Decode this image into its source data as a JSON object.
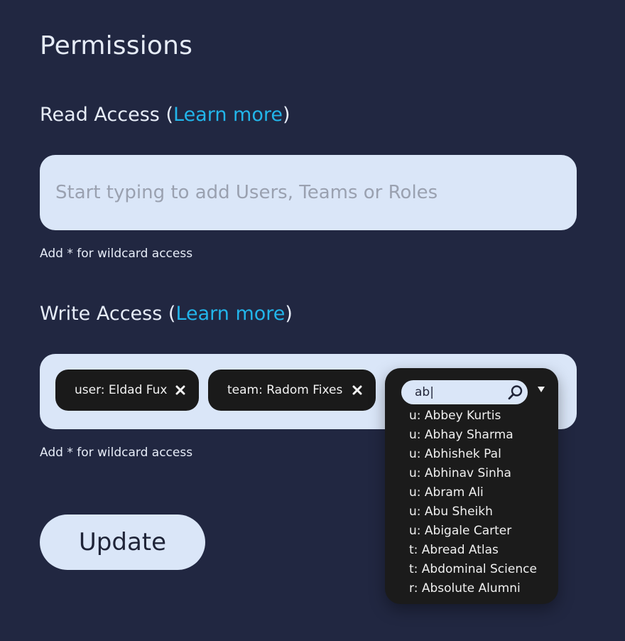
{
  "page": {
    "title": "Permissions"
  },
  "read_access": {
    "heading": "Read Access",
    "open_paren": "(",
    "learn_more": "Learn more",
    "close_paren": ")",
    "placeholder": "Start typing to add Users, Teams or Roles",
    "value": "",
    "hint": "Add * for wildcard access"
  },
  "write_access": {
    "heading": "Write Access",
    "open_paren": "(",
    "learn_more": "Learn more",
    "close_paren": ")",
    "hint": "Add * for wildcard access",
    "chips": [
      {
        "label": "user: Eldad Fux",
        "remove_icon": "close-icon"
      },
      {
        "label": "team: Radom Fixes",
        "remove_icon": "close-icon"
      }
    ],
    "search": {
      "value": "ab|",
      "icon": "search-icon",
      "toggle_icon": "caret-down-icon"
    },
    "options": [
      "u: Abbey Kurtis",
      "u: Abhay Sharma",
      "u: Abhishek Pal",
      "u: Abhinav Sinha",
      "u: Abram Ali",
      "u: Abu Sheikh",
      "u: Abigale Carter",
      "t: Abread Atlas",
      "t: Abdominal Science",
      "r: Absolute Alumni"
    ]
  },
  "actions": {
    "update_label": "Update"
  },
  "colors": {
    "background": "#212741",
    "field": "#dae6f8",
    "link": "#22b5ea",
    "chip": "#1a1a1a",
    "dropdown": "#1b1b1b"
  }
}
